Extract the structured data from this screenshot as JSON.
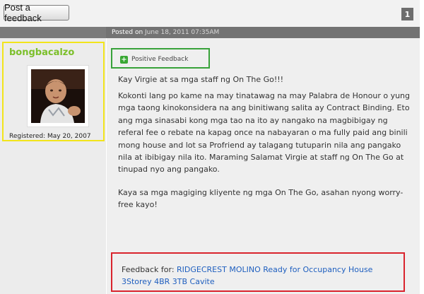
{
  "toolbar": {
    "post_feedback_label": "Post a feedback",
    "page_number": "1"
  },
  "post": {
    "posted_prefix": "Posted on",
    "posted_date": "June 18, 2011 07:35AM"
  },
  "user": {
    "username": "bongbacalzo",
    "registered": "Registered: May 20, 2007",
    "avatar_icon": "user-avatar-photo"
  },
  "feedback": {
    "type_label": "Positive Feedback",
    "icon": "plus-icon",
    "paragraphs": [
      "Kay Virgie at sa mga staff ng On The Go!!!",
      "Kokonti lang po kame na may tinatawag na may Palabra de Honour o yung mga taong  kinokonsidera na ang binitiwang salita ay Contract Binding. Eto ang mga sinasabi kong mga tao na ito ay nangako na magbibigay ng referal fee o rebate na kapag once na nabayaran o ma fully paid ang binili mong house and lot sa Profriend ay talagang tutuparin nila ang pangako nila at ibibigay nila ito. Maraming Salamat Virgie at staff ng On The Go at tinupad nyo ang pangako.",
      "Kaya sa mga magiging kliyente ng mga On The Go, asahan nyong worry-free kayo!"
    ],
    "for_label": "Feedback for:",
    "for_link": "RIDGECREST MOLINO Ready for Occupancy House 3Storey 4BR 3TB Cavite"
  }
}
